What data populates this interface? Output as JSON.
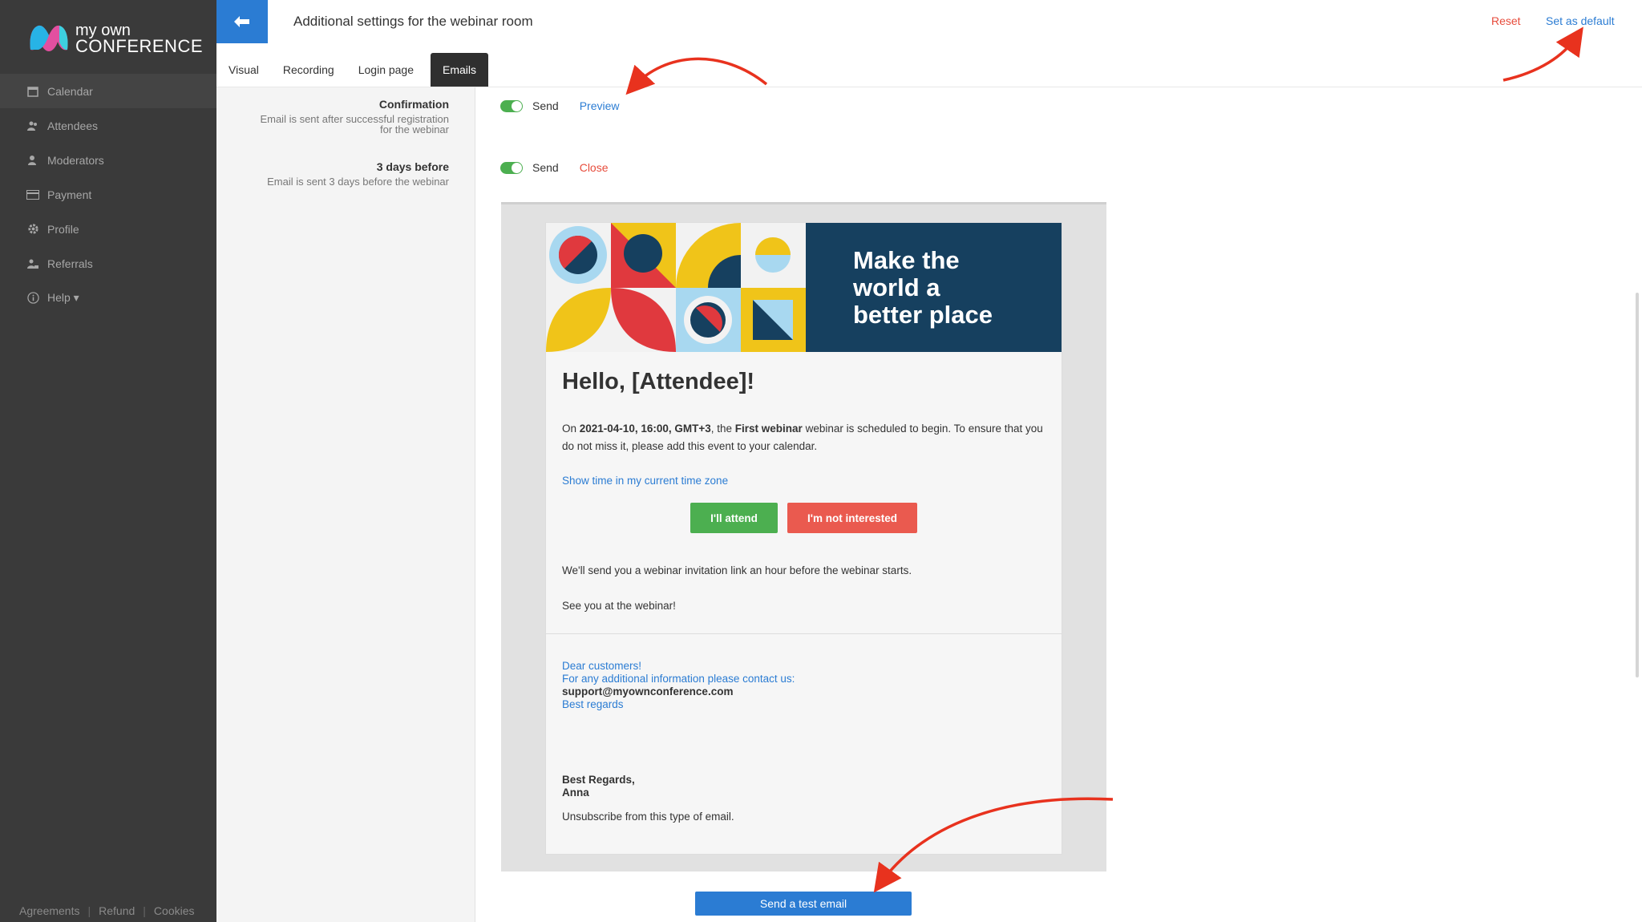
{
  "app": {
    "logo_line1": "my own",
    "logo_line2": "CONFERENCE",
    "title": "Additional settings for the webinar room",
    "reset_label": "Reset",
    "set_default_label": "Set as default"
  },
  "sidebar": {
    "items": [
      {
        "label": "Calendar",
        "icon": "calendar-icon"
      },
      {
        "label": "Attendees",
        "icon": "attendees-icon"
      },
      {
        "label": "Moderators",
        "icon": "moderators-icon"
      },
      {
        "label": "Payment",
        "icon": "credit-card-icon"
      },
      {
        "label": "Profile",
        "icon": "gear-icon"
      },
      {
        "label": "Referrals",
        "icon": "referrals-icon"
      },
      {
        "label": "Help ▾",
        "icon": "info-icon"
      }
    ],
    "footer": {
      "agreements": "Agreements",
      "refund": "Refund",
      "cookies": "Cookies",
      "sep": "|"
    }
  },
  "tabs": [
    {
      "label": "Visual"
    },
    {
      "label": "Recording"
    },
    {
      "label": "Login page"
    },
    {
      "label": "Emails",
      "active": true
    }
  ],
  "emails": [
    {
      "title": "Confirmation",
      "desc1": "Email is sent after successful registration",
      "desc2": "for the webinar",
      "send_label": "Send",
      "link_label": "Preview",
      "enabled": true
    },
    {
      "title": "3 days before",
      "desc1": "Email is sent 3 days before the webinar",
      "desc2": "",
      "send_label": "Send",
      "link_label": "Close",
      "enabled": true
    }
  ],
  "preview": {
    "banner": {
      "line1": "Make the",
      "line2": "world a",
      "line3": "better place"
    },
    "hello": "Hello, [Attendee]!",
    "p_on": "On ",
    "p_date": "2021-04-10, 16:00, GMT+3",
    "p_the": ", the ",
    "p_webinar": "First webinar",
    "p_rest": " webinar is scheduled to begin. To ensure that you do not miss it, please add this event to your calendar.",
    "tz_link": "Show time in my current time zone",
    "attend_label": "I'll attend",
    "not_interested_label": "I'm not interested",
    "line1": "We'll send you a webinar invitation link an hour before the webinar starts.",
    "line2": "See you at the webinar!",
    "contact1": "Dear customers!",
    "contact2": "For any additional information please contact us:",
    "contact_email": "support@myownconference.com",
    "contact3": "Best regards",
    "sign1": "Best Regards,",
    "sign2": "Anna",
    "unsubscribe": "Unsubscribe from this type of email."
  },
  "send_test_label": "Send a test email",
  "colors": {
    "accent": "#2b7cd3",
    "danger": "#e74c3c",
    "success": "#4caf50",
    "sidebar": "#3a3a3a",
    "banner_bg": "#16405f"
  }
}
